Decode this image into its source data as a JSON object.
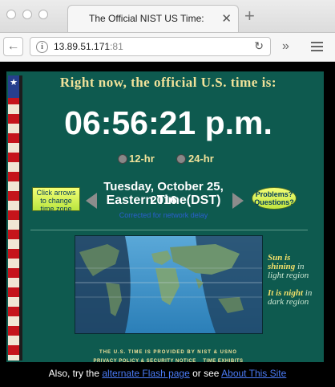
{
  "browser": {
    "tab_title": "The Official NIST US Time:",
    "url_host": "13.89.51.171",
    "url_port": ":81"
  },
  "page": {
    "headline": "Right now, the official U.S. time is:",
    "time": "06:56:21 p.m.",
    "format_options": [
      {
        "label": "12-hr",
        "selected": true
      },
      {
        "label": "24-hr",
        "selected": false
      }
    ],
    "change_zone_button": "Click arrows to change time zone",
    "date": "Tuesday, October 25, 2016",
    "zone": "Eastern Time(DST)",
    "corrected_note": "Corrected for network delay",
    "problems_button": "Problems? Questions?",
    "map_legend": {
      "day_strong": "Sun is shining",
      "day_rest": "in light region",
      "night_strong": "It is night",
      "night_rest": "in dark region"
    },
    "footer_provided": "THE U.S. TIME IS PROVIDED BY NIST & USNO",
    "footer_privacy": "PRIVACY POLICY & SECURITY NOTICE",
    "footer_exhibits": "TIME EXHIBITS",
    "also_prefix": "Also, try the",
    "alternate_link": "alternate Flash page",
    "or_see": "or see",
    "about_link": "About This Site"
  },
  "colors": {
    "background": "#0e5a4f",
    "headline": "#f1e29a",
    "link": "#4a7bf5"
  }
}
